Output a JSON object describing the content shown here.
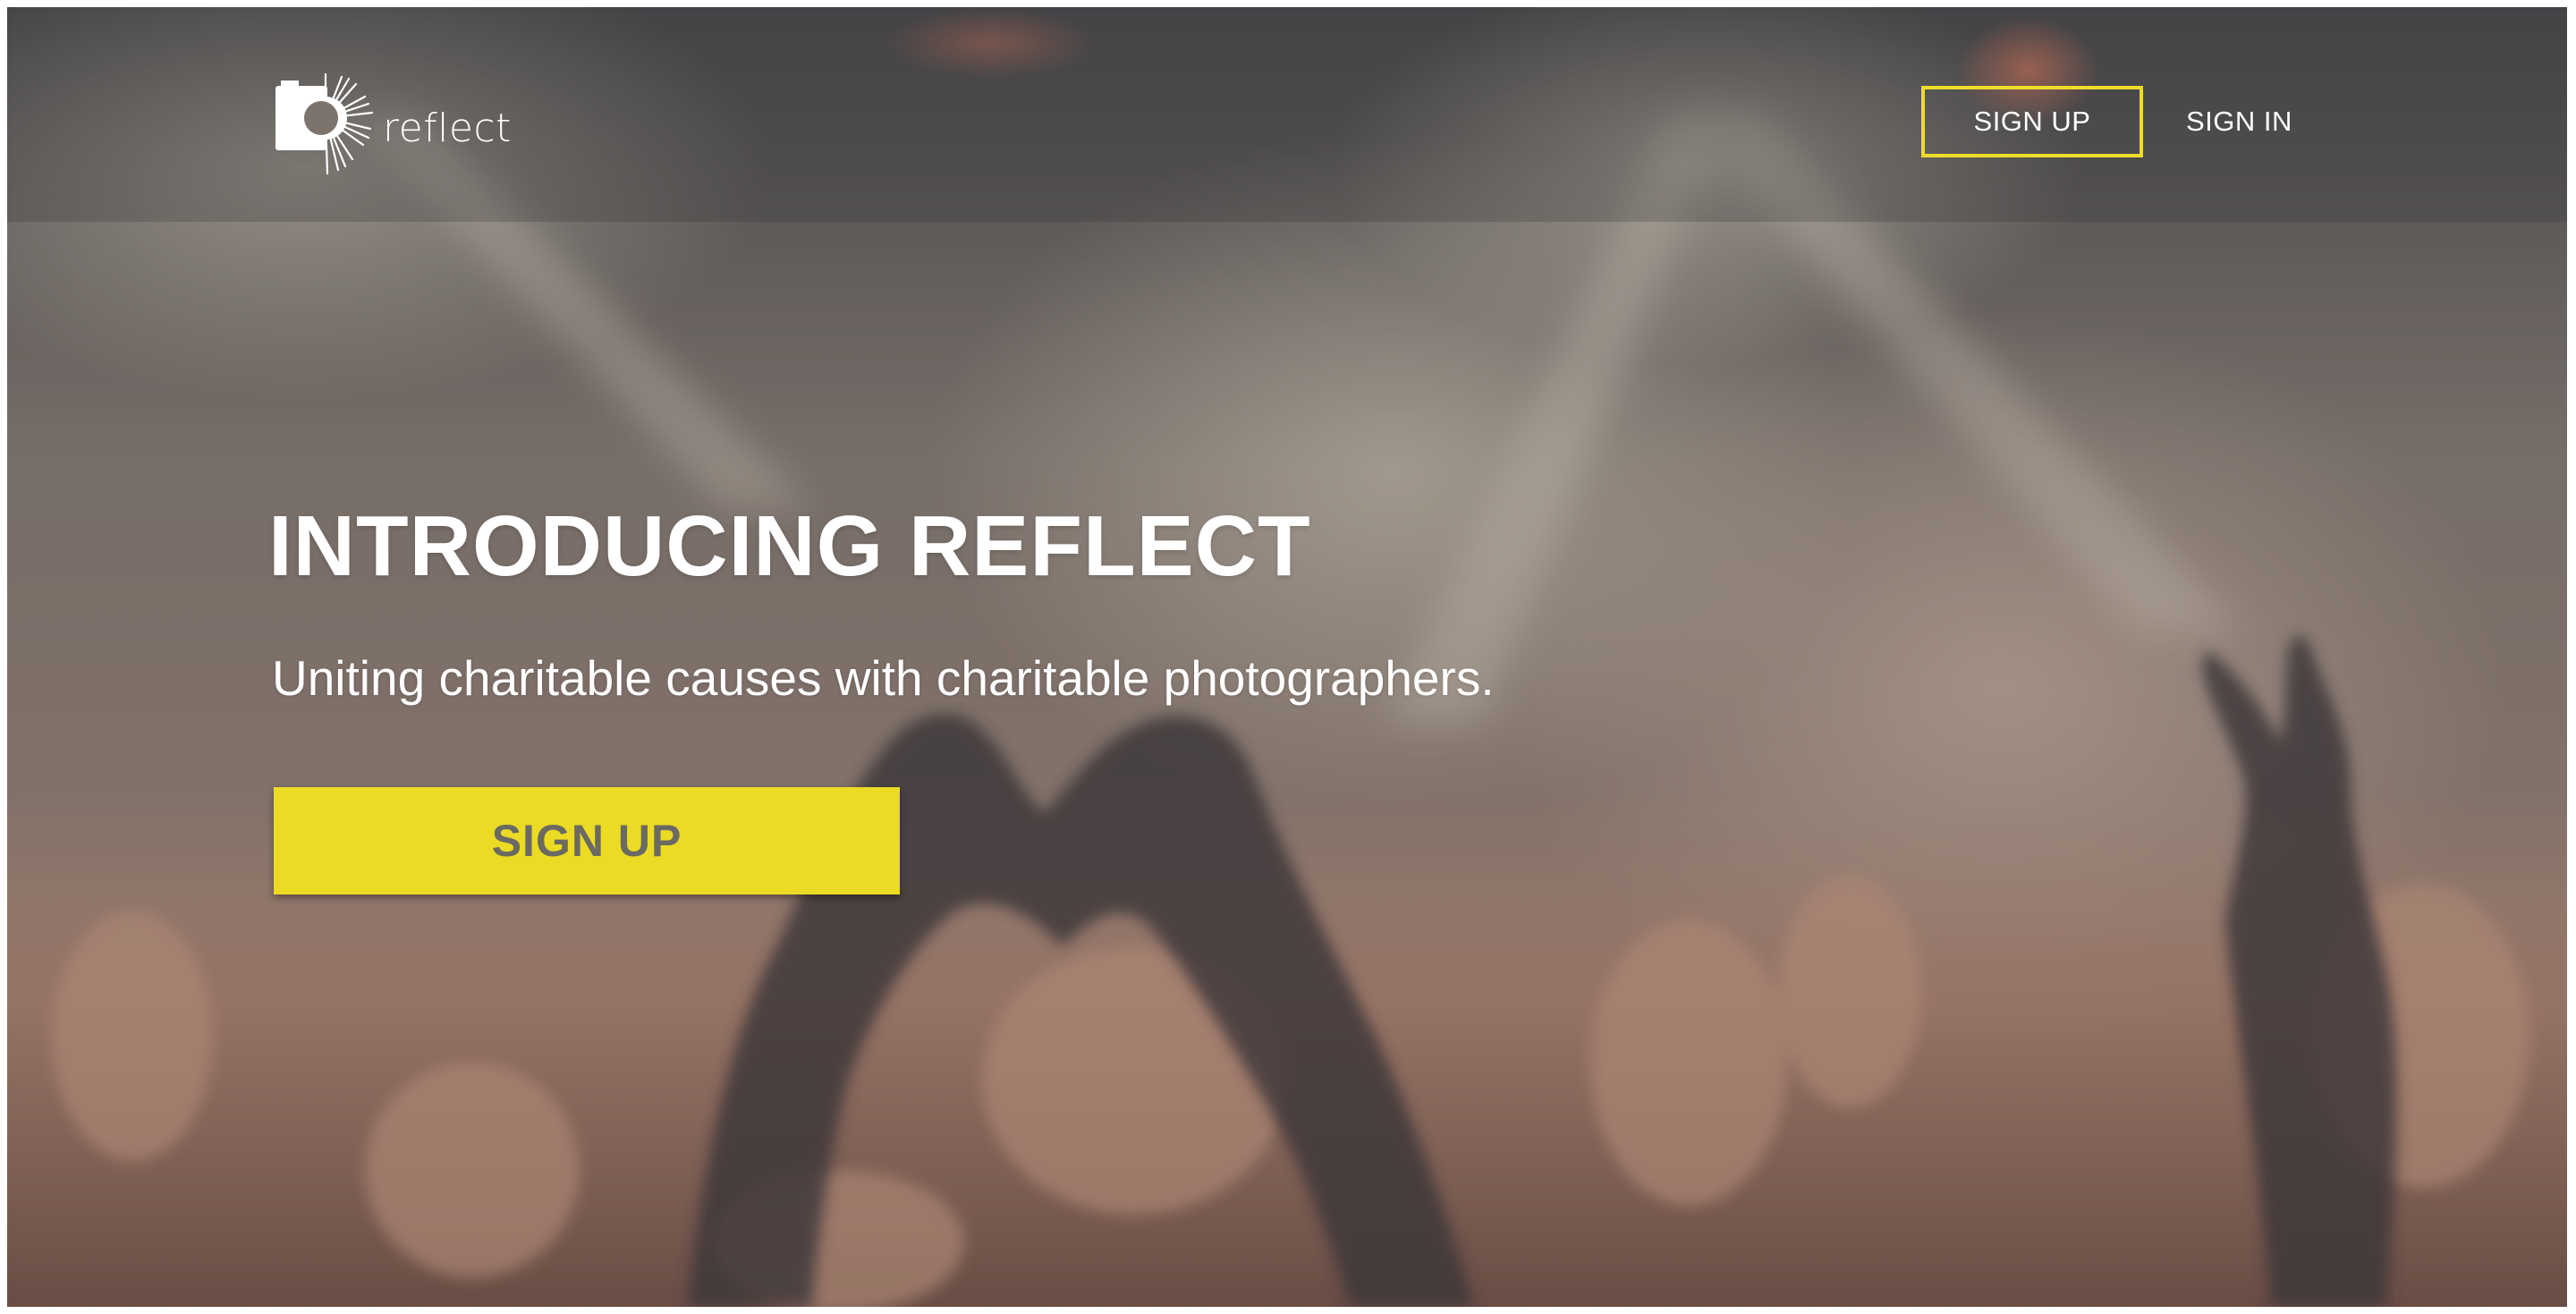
{
  "brand": {
    "name": "reflect",
    "logo_icon": "camera-sunburst-icon"
  },
  "nav": {
    "signup_label": "SIGN UP",
    "signin_label": "SIGN IN"
  },
  "hero": {
    "title": "INTRODUCING REFLECT",
    "subtitle": "Uniting charitable causes with charitable photographers.",
    "cta_label": "SIGN UP"
  },
  "colors": {
    "accent": "#ebdb24",
    "button_text": "#6b6a62",
    "text": "#ffffff"
  }
}
